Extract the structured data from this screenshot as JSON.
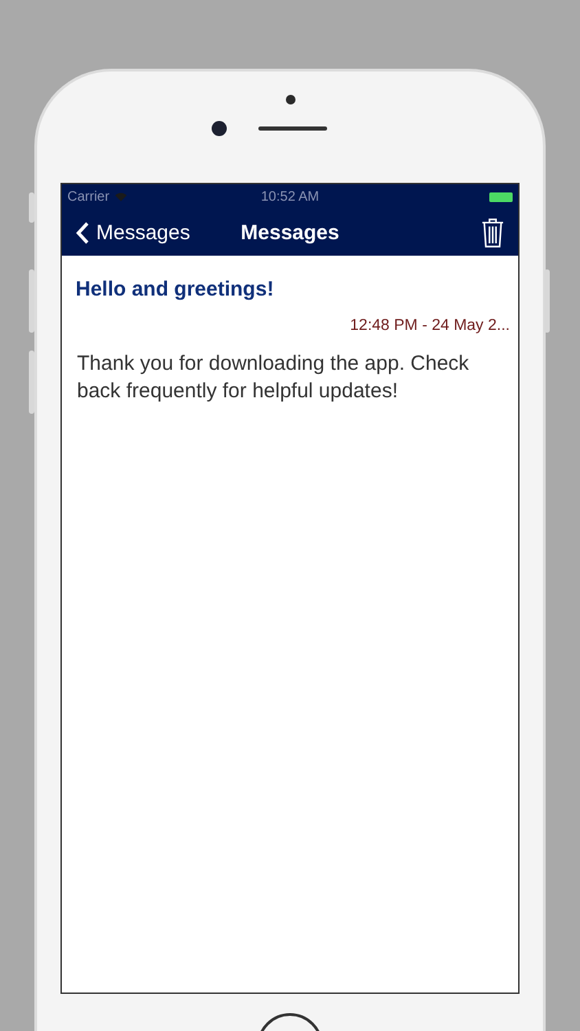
{
  "status_bar": {
    "carrier": "Carrier",
    "time": "10:52 AM"
  },
  "nav_bar": {
    "back_label": "Messages",
    "title": "Messages"
  },
  "message": {
    "title": "Hello and greetings!",
    "timestamp": "12:48 PM - 24 May 2...",
    "body": "Thank you for downloading the app. Check back frequently for helpful updates!"
  }
}
